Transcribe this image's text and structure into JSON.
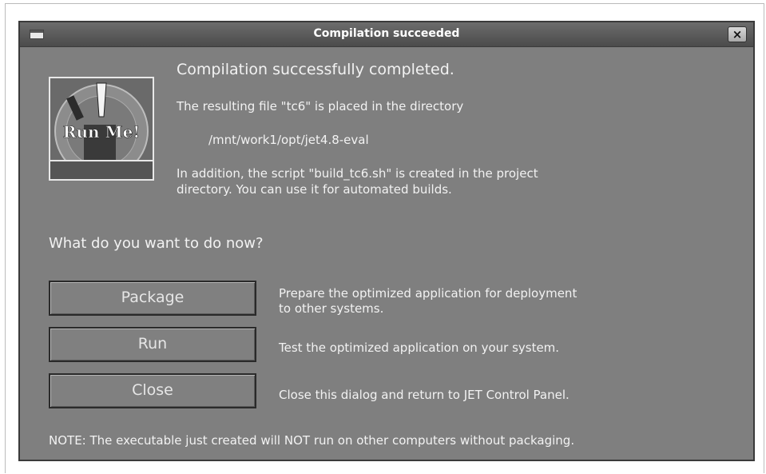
{
  "window": {
    "title": "Compilation succeeded",
    "close_glyph": "×"
  },
  "logo": {
    "text": "Run Me!",
    "icon": "run-me-logo"
  },
  "message": {
    "heading": "Compilation successfully completed.",
    "file_line": "The resulting file \"tc6\" is placed in the directory",
    "directory": "/mnt/work1/opt/jet4.8-eval",
    "script_line1": "In addition, the script \"build_tc6.sh\" is created in the project",
    "script_line2": "directory. You can use it for automated builds."
  },
  "question": "What do you want to do now?",
  "actions": [
    {
      "label": "Package",
      "desc_line1": "Prepare the optimized application for deployment",
      "desc_line2": "to other systems."
    },
    {
      "label": "Run",
      "desc_line1": "Test the optimized application on your system."
    },
    {
      "label": "Close",
      "desc_line1": "Close this dialog and return to JET Control Panel."
    }
  ],
  "note": "NOTE: The executable just created will NOT run on other computers without packaging.",
  "colors": {
    "dialog_bg": "#7f7f7f",
    "titlebar": "#555555",
    "text": "#f2f2f2"
  }
}
